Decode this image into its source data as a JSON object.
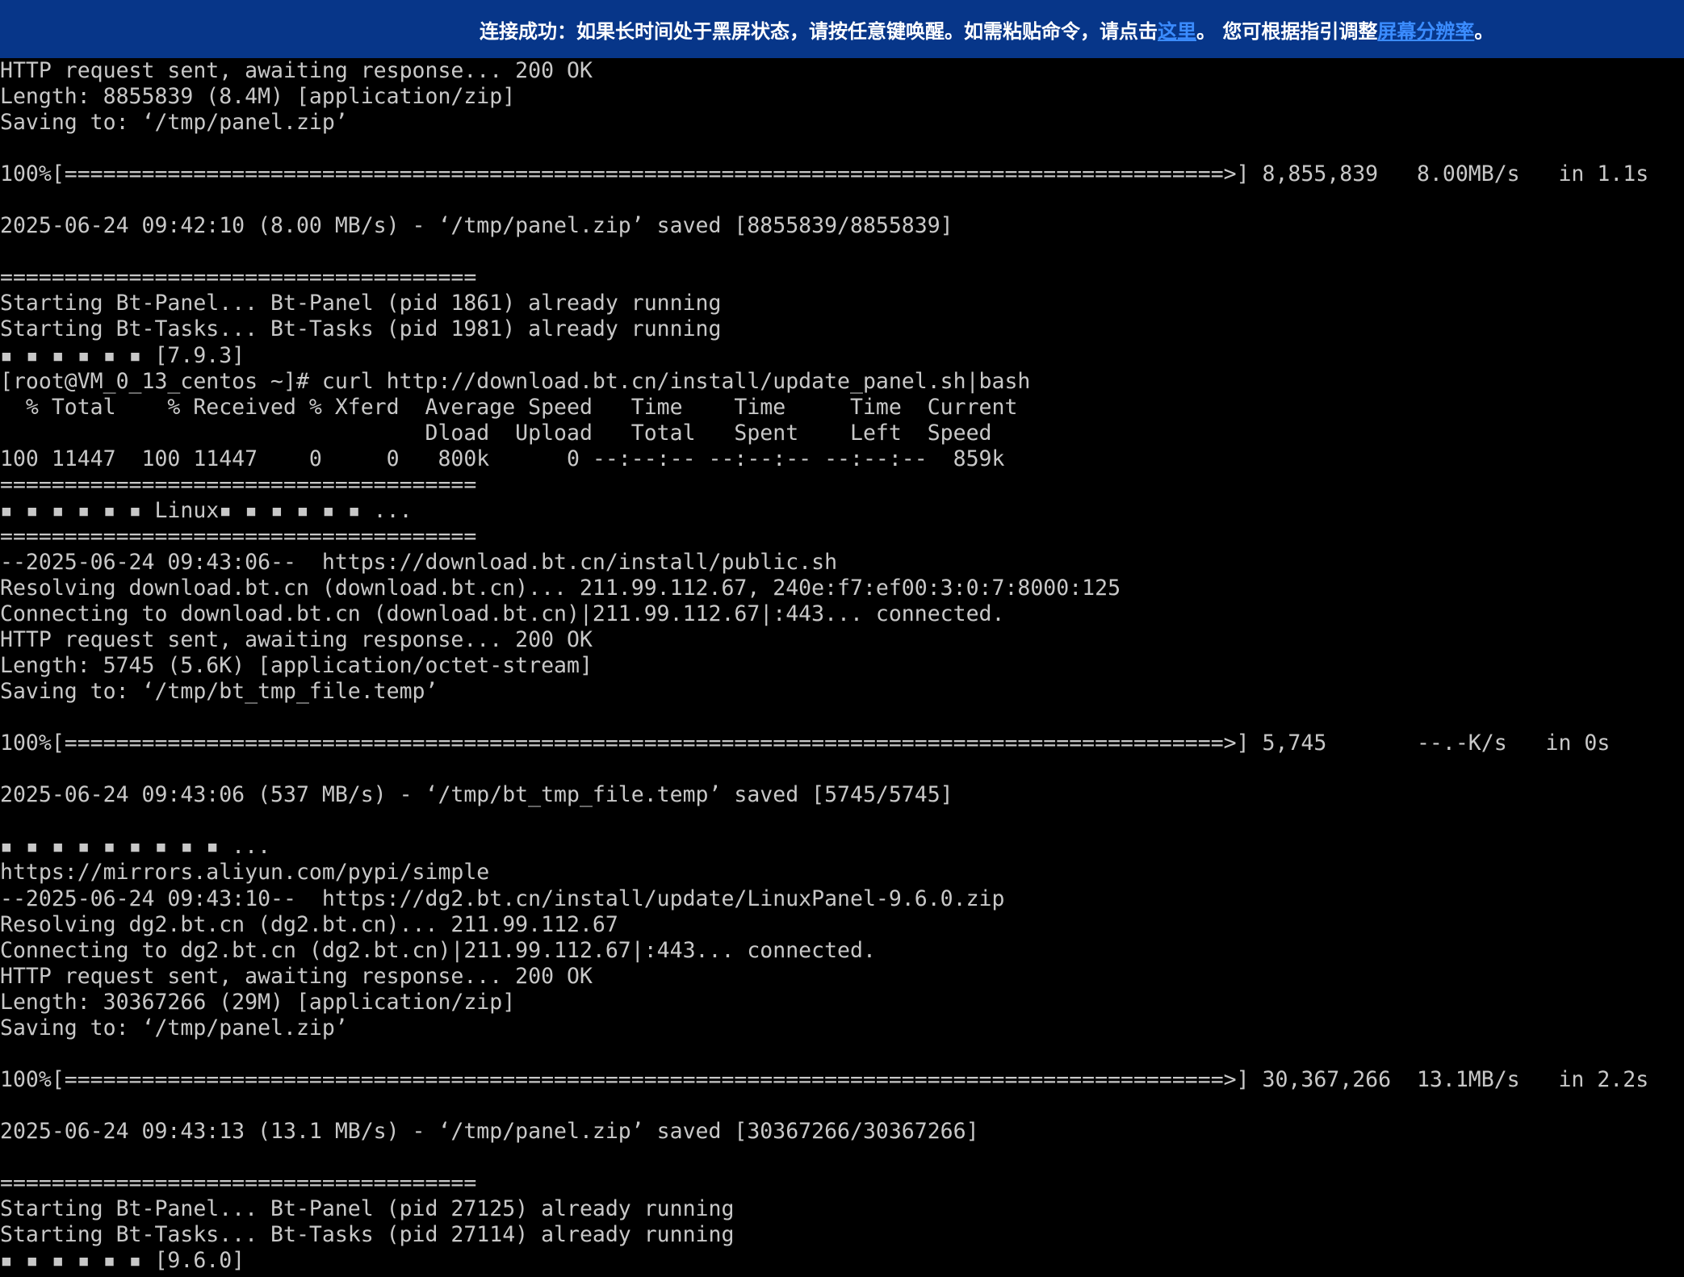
{
  "banner": {
    "message_prefix": "连接成功：如果长时间处于黑屏状态，请按任意键唤醒。如需粘贴命令，请点击",
    "paste_link": "这里",
    "message_middle": "。 您可根据指引调整",
    "resolution_link": "屏幕分辨率",
    "message_suffix": "。",
    "bg_color": "#073689",
    "link_color": "#3b8cff"
  },
  "terminal": {
    "bg_color": "#000000",
    "text_color": "#c8c8c8",
    "lines": [
      "HTTP request sent, awaiting response... 200 OK",
      "Length: 8855839 (8.4M) [application/zip]",
      "Saving to: ‘/tmp/panel.zip’",
      "",
      "100%[==========================================================================================>] 8,855,839   8.00MB/s   in 1.1s",
      "",
      "2025-06-24 09:42:10 (8.00 MB/s) - ‘/tmp/panel.zip’ saved [8855839/8855839]",
      "",
      "=====================================",
      "Starting Bt-Panel... Bt-Panel (pid 1861) already running",
      "Starting Bt-Tasks... Bt-Tasks (pid 1981) already running",
      "▪ ▪ ▪ ▪ ▪ ▪ [7.9.3]",
      "[root@VM_0_13_centos ~]# curl http://download.bt.cn/install/update_panel.sh|bash",
      "  % Total    % Received % Xferd  Average Speed   Time    Time     Time  Current",
      "                                 Dload  Upload   Total   Spent    Left  Speed",
      "100 11447  100 11447    0     0   800k      0 --:--:-- --:--:-- --:--:--  859k",
      "=====================================",
      "▪ ▪ ▪ ▪ ▪ ▪ Linux▪ ▪ ▪ ▪ ▪ ▪ ...",
      "=====================================",
      "--2025-06-24 09:43:06--  https://download.bt.cn/install/public.sh",
      "Resolving download.bt.cn (download.bt.cn)... 211.99.112.67, 240e:f7:ef00:3:0:7:8000:125",
      "Connecting to download.bt.cn (download.bt.cn)|211.99.112.67|:443... connected.",
      "HTTP request sent, awaiting response... 200 OK",
      "Length: 5745 (5.6K) [application/octet-stream]",
      "Saving to: ‘/tmp/bt_tmp_file.temp’",
      "",
      "100%[==========================================================================================>] 5,745       --.-K/s   in 0s",
      "",
      "2025-06-24 09:43:06 (537 MB/s) - ‘/tmp/bt_tmp_file.temp’ saved [5745/5745]",
      "",
      "▪ ▪ ▪ ▪ ▪ ▪ ▪ ▪ ▪ ...",
      "https://mirrors.aliyun.com/pypi/simple",
      "--2025-06-24 09:43:10--  https://dg2.bt.cn/install/update/LinuxPanel-9.6.0.zip",
      "Resolving dg2.bt.cn (dg2.bt.cn)... 211.99.112.67",
      "Connecting to dg2.bt.cn (dg2.bt.cn)|211.99.112.67|:443... connected.",
      "HTTP request sent, awaiting response... 200 OK",
      "Length: 30367266 (29M) [application/zip]",
      "Saving to: ‘/tmp/panel.zip’",
      "",
      "100%[==========================================================================================>] 30,367,266  13.1MB/s   in 2.2s",
      "",
      "2025-06-24 09:43:13 (13.1 MB/s) - ‘/tmp/panel.zip’ saved [30367266/30367266]",
      "",
      "=====================================",
      "Starting Bt-Panel... Bt-Panel (pid 27125) already running",
      "Starting Bt-Tasks... Bt-Tasks (pid 27114) already running",
      "▪ ▪ ▪ ▪ ▪ ▪ [9.6.0]"
    ]
  }
}
